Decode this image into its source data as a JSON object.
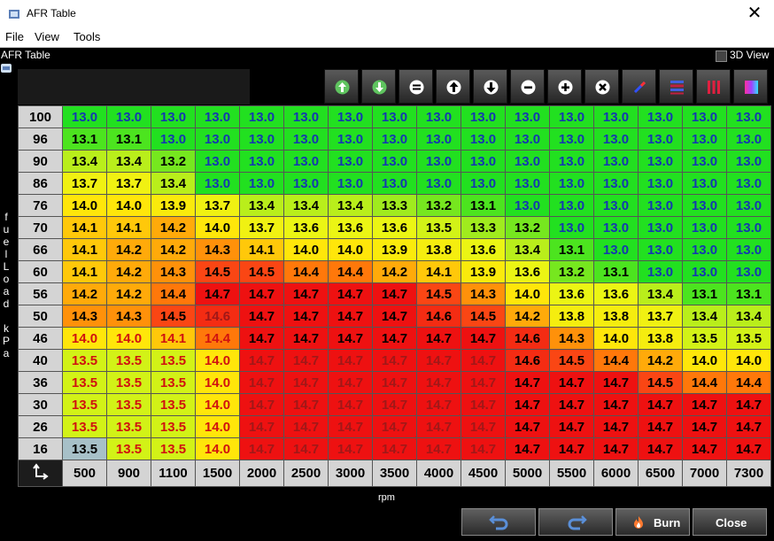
{
  "window": {
    "title": "AFR Table"
  },
  "menu": {
    "file": "File",
    "view": "View",
    "tools": "Tools"
  },
  "panel": {
    "title": "AFR Table",
    "view3d_label": "3D View",
    "view3d_checked": false
  },
  "axis": {
    "y_label": "fuelLoad kPa",
    "x_label": "rpm"
  },
  "toolbar": {
    "buttons": [
      "arrow-up-green-icon",
      "arrow-down-green-icon",
      "equals-icon",
      "arrow-up-icon",
      "arrow-down-icon",
      "minus-icon",
      "plus-icon",
      "multiply-icon",
      "interpolate-icon",
      "horizontal-lines-icon",
      "vertical-lines-icon",
      "smooth-gradient-icon"
    ]
  },
  "table": {
    "rpm": [
      "500",
      "900",
      "1100",
      "1500",
      "2000",
      "2500",
      "3000",
      "3500",
      "4000",
      "4500",
      "5000",
      "5500",
      "6000",
      "6500",
      "7000",
      "7300"
    ],
    "rows": [
      {
        "load": "100",
        "values": [
          "13.0",
          "13.0",
          "13.0",
          "13.0",
          "13.0",
          "13.0",
          "13.0",
          "13.0",
          "13.0",
          "13.0",
          "13.0",
          "13.0",
          "13.0",
          "13.0",
          "13.0",
          "13.0"
        ]
      },
      {
        "load": "96",
        "values": [
          "13.1",
          "13.1",
          "13.0",
          "13.0",
          "13.0",
          "13.0",
          "13.0",
          "13.0",
          "13.0",
          "13.0",
          "13.0",
          "13.0",
          "13.0",
          "13.0",
          "13.0",
          "13.0"
        ]
      },
      {
        "load": "90",
        "values": [
          "13.4",
          "13.4",
          "13.2",
          "13.0",
          "13.0",
          "13.0",
          "13.0",
          "13.0",
          "13.0",
          "13.0",
          "13.0",
          "13.0",
          "13.0",
          "13.0",
          "13.0",
          "13.0"
        ]
      },
      {
        "load": "86",
        "values": [
          "13.7",
          "13.7",
          "13.4",
          "13.0",
          "13.0",
          "13.0",
          "13.0",
          "13.0",
          "13.0",
          "13.0",
          "13.0",
          "13.0",
          "13.0",
          "13.0",
          "13.0",
          "13.0"
        ]
      },
      {
        "load": "76",
        "values": [
          "14.0",
          "14.0",
          "13.9",
          "13.7",
          "13.4",
          "13.4",
          "13.4",
          "13.3",
          "13.2",
          "13.1",
          "13.0",
          "13.0",
          "13.0",
          "13.0",
          "13.0",
          "13.0"
        ]
      },
      {
        "load": "70",
        "values": [
          "14.1",
          "14.1",
          "14.2",
          "14.0",
          "13.7",
          "13.6",
          "13.6",
          "13.6",
          "13.5",
          "13.3",
          "13.2",
          "13.0",
          "13.0",
          "13.0",
          "13.0",
          "13.0"
        ]
      },
      {
        "load": "66",
        "values": [
          "14.1",
          "14.2",
          "14.2",
          "14.3",
          "14.1",
          "14.0",
          "14.0",
          "13.9",
          "13.8",
          "13.6",
          "13.4",
          "13.1",
          "13.0",
          "13.0",
          "13.0",
          "13.0"
        ]
      },
      {
        "load": "60",
        "values": [
          "14.1",
          "14.2",
          "14.3",
          "14.5",
          "14.5",
          "14.4",
          "14.4",
          "14.2",
          "14.1",
          "13.9",
          "13.6",
          "13.2",
          "13.1",
          "13.0",
          "13.0",
          "13.0"
        ]
      },
      {
        "load": "56",
        "values": [
          "14.2",
          "14.2",
          "14.4",
          "14.7",
          "14.7",
          "14.7",
          "14.7",
          "14.7",
          "14.5",
          "14.3",
          "14.0",
          "13.6",
          "13.6",
          "13.4",
          "13.1",
          "13.1"
        ]
      },
      {
        "load": "50",
        "values": [
          "14.3",
          "14.3",
          "14.5",
          "14.6",
          "14.7",
          "14.7",
          "14.7",
          "14.7",
          "14.6",
          "14.5",
          "14.2",
          "13.8",
          "13.8",
          "13.7",
          "13.4",
          "13.4"
        ]
      },
      {
        "load": "46",
        "values": [
          "14.0",
          "14.0",
          "14.1",
          "14.4",
          "14.7",
          "14.7",
          "14.7",
          "14.7",
          "14.7",
          "14.7",
          "14.6",
          "14.3",
          "14.0",
          "13.8",
          "13.5",
          "13.5"
        ]
      },
      {
        "load": "40",
        "values": [
          "13.5",
          "13.5",
          "13.5",
          "14.0",
          "14.7",
          "14.7",
          "14.7",
          "14.7",
          "14.7",
          "14.7",
          "14.6",
          "14.5",
          "14.4",
          "14.2",
          "14.0",
          "14.0"
        ]
      },
      {
        "load": "36",
        "values": [
          "13.5",
          "13.5",
          "13.5",
          "14.0",
          "14.7",
          "14.7",
          "14.7",
          "14.7",
          "14.7",
          "14.7",
          "14.7",
          "14.7",
          "14.7",
          "14.5",
          "14.4",
          "14.4"
        ]
      },
      {
        "load": "30",
        "values": [
          "13.5",
          "13.5",
          "13.5",
          "14.0",
          "14.7",
          "14.7",
          "14.7",
          "14.7",
          "14.7",
          "14.7",
          "14.7",
          "14.7",
          "14.7",
          "14.7",
          "14.7",
          "14.7"
        ]
      },
      {
        "load": "26",
        "values": [
          "13.5",
          "13.5",
          "13.5",
          "14.0",
          "14.7",
          "14.7",
          "14.7",
          "14.7",
          "14.7",
          "14.7",
          "14.7",
          "14.7",
          "14.7",
          "14.7",
          "14.7",
          "14.7"
        ]
      },
      {
        "load": "16",
        "values": [
          "13.5",
          "13.5",
          "13.5",
          "14.0",
          "14.7",
          "14.7",
          "14.7",
          "14.7",
          "14.7",
          "14.7",
          "14.7",
          "14.7",
          "14.7",
          "14.7",
          "14.7",
          "14.7"
        ]
      }
    ]
  },
  "buttons": {
    "burn": "Burn",
    "close": "Close"
  },
  "colors": {
    "accent_blue": "#1438b0",
    "cell_green": "#22e020",
    "cell_red": "#ee1111",
    "selected_cell": "#a7c0c8"
  }
}
